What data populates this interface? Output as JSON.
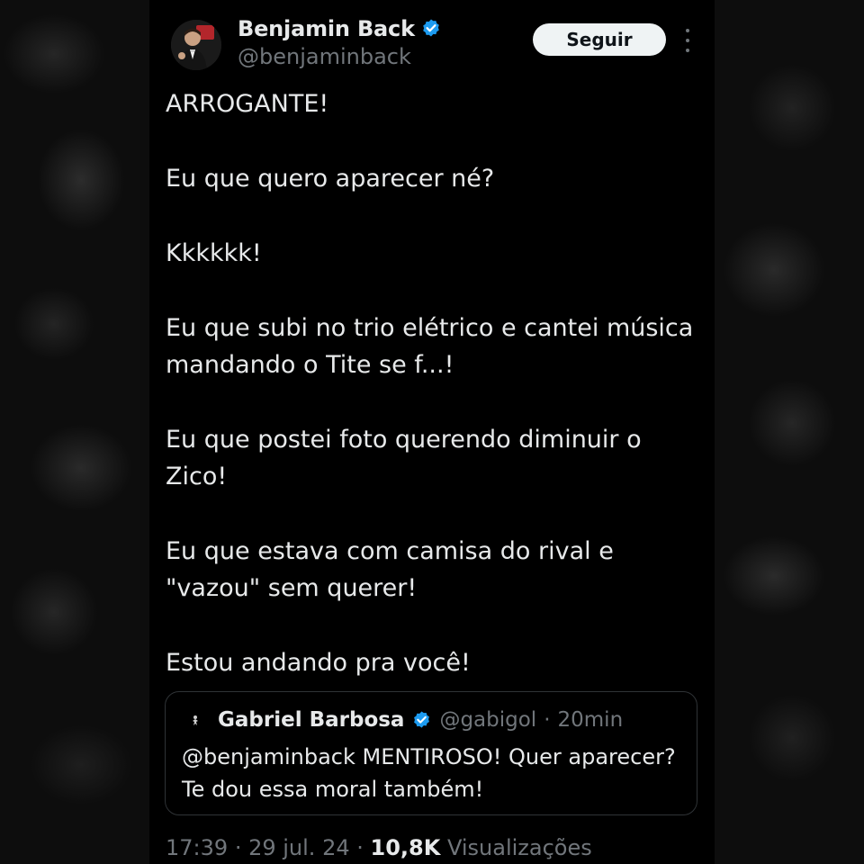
{
  "author": {
    "name": "Benjamin Back",
    "handle": "@benjaminback",
    "avatar_icon": "profile-photo-avatar",
    "verified_icon": "verified-badge-icon",
    "verified_color": "#1d9bf0"
  },
  "header": {
    "follow_label": "Seguir",
    "more_icon": "more-options-icon"
  },
  "tweet": {
    "paragraphs": [
      "ARROGANTE!",
      "Eu que quero aparecer né?",
      "Kkkkkk!",
      "Eu que subi no trio elétrico e cantei música mandando o Tite se f...!",
      "Eu que postei foto querendo diminuir o Zico!",
      "Eu que estava com camisa do rival e \"vazou\" sem querer!",
      "Estou andando pra você!"
    ]
  },
  "quoted_tweet": {
    "name": "Gabriel Barbosa",
    "handle": "@gabigol",
    "separator": "·",
    "time": "20min",
    "text": "@benjaminback MENTIROSO! Quer aparecer? Te dou essa moral também!",
    "avatar_icon": "small-profile-avatar",
    "verified_icon": "verified-badge-icon"
  },
  "footer": {
    "time": "17:39",
    "sep1": "·",
    "date": "29 jul. 24",
    "sep2": "·",
    "views_count": "10,8K",
    "views_label": "Visualizações"
  },
  "colors": {
    "background": "#000000",
    "text": "#e7e9ea",
    "muted": "#71767b",
    "accent": "#1d9bf0",
    "button_bg": "#eff3f4"
  }
}
